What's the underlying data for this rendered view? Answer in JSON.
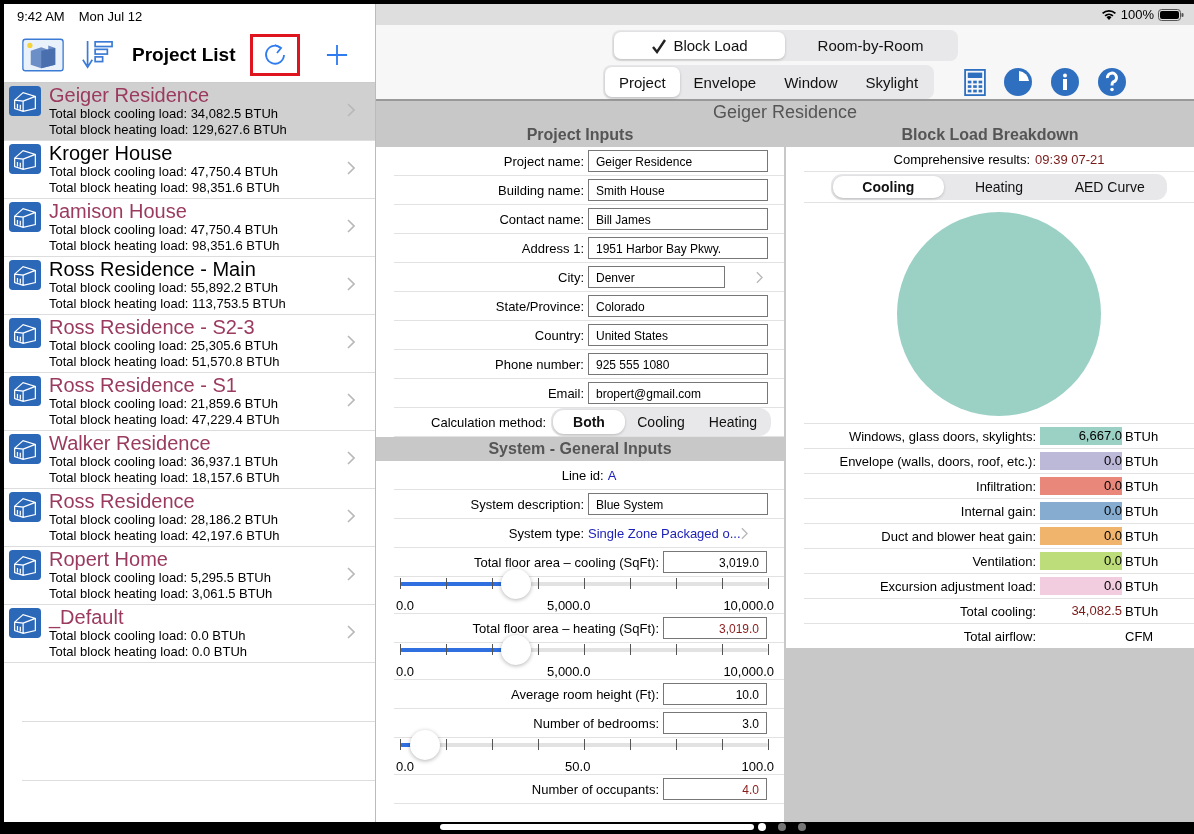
{
  "status_bar": {
    "time": "9:42 AM",
    "date": "Mon Jul 12",
    "battery": "100%"
  },
  "sidebar": {
    "title": "Project List",
    "refresh_highlighted": true,
    "projects": [
      {
        "name": "Geiger Residence",
        "color": "#9b3a5f",
        "cooling": "Total block cooling load: 34,082.5 BTUh",
        "heating": "Total block heating load: 129,627.6 BTUh",
        "selected": true
      },
      {
        "name": "Kroger House",
        "color": "#000000",
        "cooling": "Total block cooling load: 47,750.4 BTUh",
        "heating": "Total block heating load: 98,351.6 BTUh",
        "selected": false
      },
      {
        "name": "Jamison House",
        "color": "#9b3a5f",
        "cooling": "Total block cooling load: 47,750.4 BTUh",
        "heating": "Total block heating load: 98,351.6 BTUh",
        "selected": false
      },
      {
        "name": "Ross Residence - Main",
        "color": "#000000",
        "cooling": "Total block cooling load: 55,892.2 BTUh",
        "heating": "Total block heating load: 113,753.5 BTUh",
        "selected": false
      },
      {
        "name": "Ross Residence - S2-3",
        "color": "#9b3a5f",
        "cooling": "Total block cooling load: 25,305.6 BTUh",
        "heating": "Total block heating load: 51,570.8 BTUh",
        "selected": false
      },
      {
        "name": "Ross Residence - S1",
        "color": "#9b3a5f",
        "cooling": "Total block cooling load: 21,859.6 BTUh",
        "heating": "Total block heating load: 47,229.4 BTUh",
        "selected": false
      },
      {
        "name": "Walker Residence",
        "color": "#9b3a5f",
        "cooling": "Total block cooling load: 36,937.1 BTUh",
        "heating": "Total block heating load: 18,157.6 BTUh",
        "selected": false
      },
      {
        "name": "Ross Residence",
        "color": "#9b3a5f",
        "cooling": "Total block cooling load: 28,186.2 BTUh",
        "heating": "Total block heating load: 42,197.6 BTUh",
        "selected": false
      },
      {
        "name": "Ropert Home",
        "color": "#9b3a5f",
        "cooling": "Total block cooling load: 5,295.5 BTUh",
        "heating": "Total block heating load: 3,061.5 BTUh",
        "selected": false
      },
      {
        "name": "_Default",
        "color": "#9b3a5f",
        "cooling": "Total block cooling load: 0.0 BTUh",
        "heating": "Total block heating load: 0.0 BTUh",
        "selected": false
      }
    ]
  },
  "mode_tabs": [
    {
      "label": "Block Load",
      "selected": true
    },
    {
      "label": "Room-by-Room",
      "selected": false
    }
  ],
  "section_tabs": [
    {
      "label": "Project",
      "selected": true
    },
    {
      "label": "Envelope",
      "selected": false
    },
    {
      "label": "Window",
      "selected": false
    },
    {
      "label": "Skylight",
      "selected": false
    }
  ],
  "project_title": "Geiger Residence",
  "project_inputs": {
    "title": "Project Inputs",
    "fields": [
      {
        "label": "Project name:",
        "value": "Geiger Residence",
        "kind": "field"
      },
      {
        "label": "Building name:",
        "value": "Smith House",
        "kind": "field"
      },
      {
        "label": "Contact name:",
        "value": "Bill James",
        "kind": "field"
      },
      {
        "label": "Address 1:",
        "value": "1951 Harbor Bay Pkwy.",
        "kind": "field"
      },
      {
        "label": "City:",
        "value": "Denver",
        "kind": "picker"
      },
      {
        "label": "State/Province:",
        "value": "Colorado",
        "kind": "field"
      },
      {
        "label": "Country:",
        "value": "United States",
        "kind": "field"
      },
      {
        "label": "Phone number:",
        "value": "925 555 1080",
        "kind": "field"
      },
      {
        "label": "Email:",
        "value": "bropert@gmail.com",
        "kind": "field"
      }
    ],
    "calculation_method": {
      "label": "Calculation method:",
      "options": [
        {
          "label": "Both",
          "selected": true
        },
        {
          "label": "Cooling",
          "selected": false
        },
        {
          "label": "Heating",
          "selected": false
        }
      ]
    }
  },
  "system": {
    "title": "System - General Inputs",
    "rows": [
      {
        "kind": "text",
        "label": "Line id:",
        "value": "A"
      },
      {
        "kind": "field",
        "label": "System description:",
        "value": "Blue System"
      },
      {
        "kind": "link",
        "label": "System type:",
        "value": "Single Zone Packaged o..."
      },
      {
        "kind": "number",
        "label": "Total floor area – cooling (SqFt):",
        "value": "3,019.0",
        "highlighted": false
      },
      {
        "kind": "slider",
        "level": 0.3019,
        "min": "0.0",
        "mid": "5,000.0",
        "max": "10,000.0"
      },
      {
        "kind": "number",
        "label": "Total floor area – heating (SqFt):",
        "value": "3,019.0",
        "highlighted": true
      },
      {
        "kind": "slider",
        "level": 0.3019,
        "min": "0.0",
        "mid": "5,000.0",
        "max": "10,000.0"
      },
      {
        "kind": "number",
        "label": "Average room height (Ft):",
        "value": "10.0",
        "highlighted": false
      },
      {
        "kind": "number",
        "label": "Number of bedrooms:",
        "value": "3.0",
        "highlighted": false
      },
      {
        "kind": "slider",
        "level": 0.03,
        "min": "0.0",
        "mid": "50.0",
        "max": "100.0"
      },
      {
        "kind": "number",
        "label": "Number of occupants:",
        "value": "4.0",
        "highlighted": true
      }
    ]
  },
  "breakdown": {
    "title": "Block Load Breakdown",
    "results_label": "Comprehensive results:",
    "results_value": "09:39 07-21",
    "tabs": [
      {
        "label": "Cooling",
        "selected": true
      },
      {
        "label": "Heating",
        "selected": false
      },
      {
        "label": "AED Curve",
        "selected": false
      }
    ],
    "rows": [
      {
        "label": "Windows, glass doors, skylights:",
        "value": "6,667.0",
        "unit": "BTUh",
        "color": "#9bd0c5"
      },
      {
        "label": "Envelope (walls, doors, roof, etc.):",
        "value": "0.0",
        "unit": "BTUh",
        "color": "#bcb8d8"
      },
      {
        "label": "Infiltration:",
        "value": "0.0",
        "unit": "BTUh",
        "color": "#e8877a"
      },
      {
        "label": "Internal gain:",
        "value": "0.0",
        "unit": "BTUh",
        "color": "#86acd0"
      },
      {
        "label": "Duct and blower heat gain:",
        "value": "0.0",
        "unit": "BTUh",
        "color": "#f0b46c"
      },
      {
        "label": "Ventilation:",
        "value": "0.0",
        "unit": "BTUh",
        "color": "#bddc7a"
      },
      {
        "label": "Excursion adjustment load:",
        "value": "0.0",
        "unit": "BTUh",
        "color": "#f2cde0"
      }
    ],
    "total": {
      "label": "Total cooling:",
      "value": "34,082.5",
      "unit": "BTUh"
    },
    "airflow": {
      "label": "Total airflow:",
      "unit": "CFM"
    }
  }
}
